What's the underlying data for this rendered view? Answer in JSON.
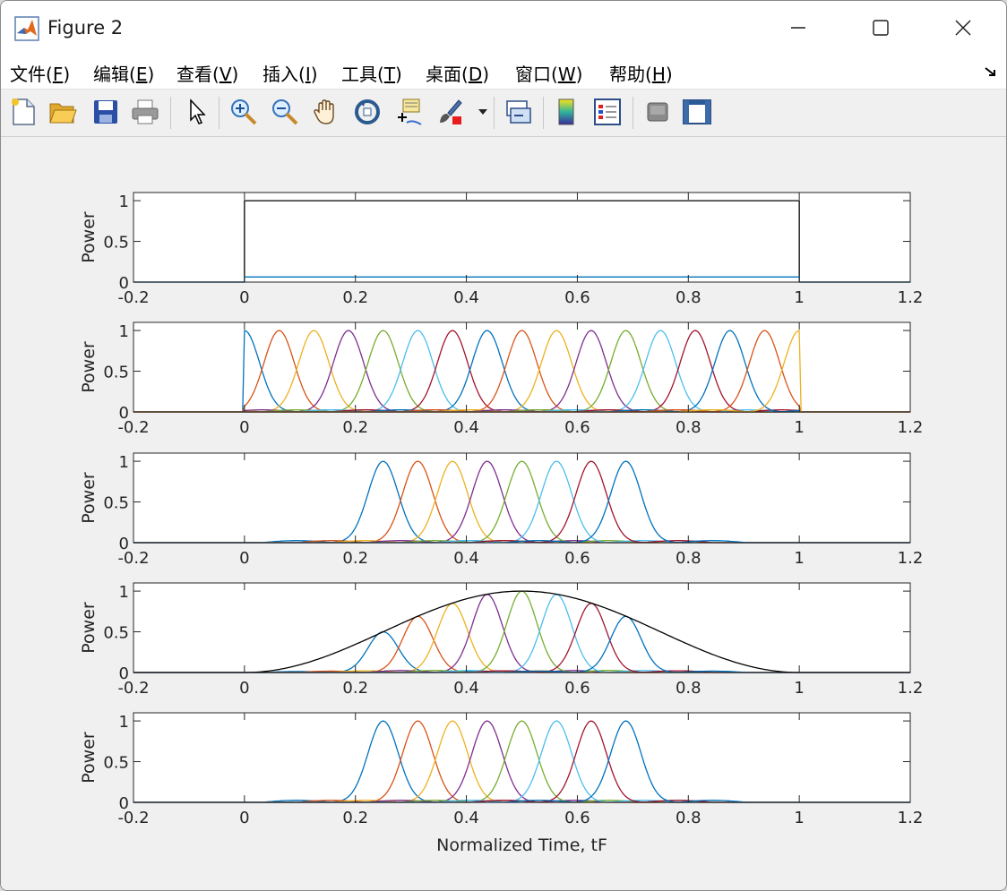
{
  "window": {
    "title": "Figure 2"
  },
  "menu": [
    {
      "text": "文件(",
      "key": "F",
      "end": ")"
    },
    {
      "text": "编辑(",
      "key": "E",
      "end": ")"
    },
    {
      "text": "查看(",
      "key": "V",
      "end": ")"
    },
    {
      "text": "插入(",
      "key": "I",
      "end": ")"
    },
    {
      "text": "工具(",
      "key": "T",
      "end": ")"
    },
    {
      "text": "桌面(",
      "key": "D",
      "end": ")"
    },
    {
      "text": "窗口(",
      "key": "W",
      "end": ")"
    },
    {
      "text": "帮助(",
      "key": "H",
      "end": ")"
    }
  ],
  "toolbar": [
    "new-figure-icon",
    "open-file-icon",
    "save-icon",
    "print-icon",
    "pointer-icon",
    "zoom-in-icon",
    "zoom-out-icon",
    "pan-hand-icon",
    "rotate-3d-icon",
    "data-cursor-icon",
    "brush-icon",
    "brush-dropdown-icon",
    "link-plot-icon",
    "colorbar-icon",
    "legend-icon",
    "hide-plot-tools-icon",
    "show-plot-tools-icon"
  ],
  "chart_data": {
    "type": "line",
    "xlabel": "Normalized Time, tF",
    "ylabel": "Power",
    "xlim": [
      -0.2,
      1.2
    ],
    "ylim": [
      0,
      1.1
    ],
    "xticks": [
      "-0.2",
      "0",
      "0.2",
      "0.4",
      "0.6",
      "0.8",
      "1",
      "1.2"
    ],
    "yticks": [
      "0",
      "0.5",
      "1"
    ],
    "series_colors": [
      "#0072bd",
      "#d95319",
      "#edb120",
      "#7e2f8e",
      "#77ac30",
      "#4dbeee",
      "#a2142f"
    ],
    "pulse_width": 0.0625,
    "panels": [
      {
        "kind": "rect",
        "rect": {
          "x_start": 0,
          "x_end": 1,
          "height": 1,
          "color": "#000000"
        },
        "baseline": {
          "x_start": 0,
          "x_end": 1,
          "level": 0.0625,
          "color": "#0072bd"
        }
      },
      {
        "kind": "pulses",
        "centers": [
          0,
          0.0625,
          0.125,
          0.1875,
          0.25,
          0.3125,
          0.375,
          0.4375,
          0.5,
          0.5625,
          0.625,
          0.6875,
          0.75,
          0.8125,
          0.875,
          0.9375,
          1
        ],
        "peaks": [
          1,
          1,
          1,
          1,
          1,
          1,
          1,
          1,
          1,
          1,
          1,
          1,
          1,
          1,
          1,
          1,
          1
        ],
        "clip": [
          0,
          1
        ]
      },
      {
        "kind": "pulses",
        "centers": [
          0.25,
          0.3125,
          0.375,
          0.4375,
          0.5,
          0.5625,
          0.625,
          0.6875
        ],
        "peaks": [
          1,
          1,
          1,
          1,
          1,
          1,
          1,
          1
        ]
      },
      {
        "kind": "pulses",
        "centers": [
          0.25,
          0.3125,
          0.375,
          0.4375,
          0.5,
          0.5625,
          0.625,
          0.6875
        ],
        "peaks": [
          0.5,
          0.69,
          0.85,
          0.96,
          1.0,
          0.96,
          0.85,
          0.69
        ],
        "envelope": {
          "type": "hann",
          "x_start": 0,
          "x_end": 1,
          "peak": 1,
          "color": "#000000"
        }
      },
      {
        "kind": "pulses",
        "centers": [
          0.25,
          0.3125,
          0.375,
          0.4375,
          0.5,
          0.5625,
          0.625,
          0.6875
        ],
        "peaks": [
          1,
          1,
          1,
          1,
          1,
          1,
          1,
          1
        ]
      }
    ]
  }
}
